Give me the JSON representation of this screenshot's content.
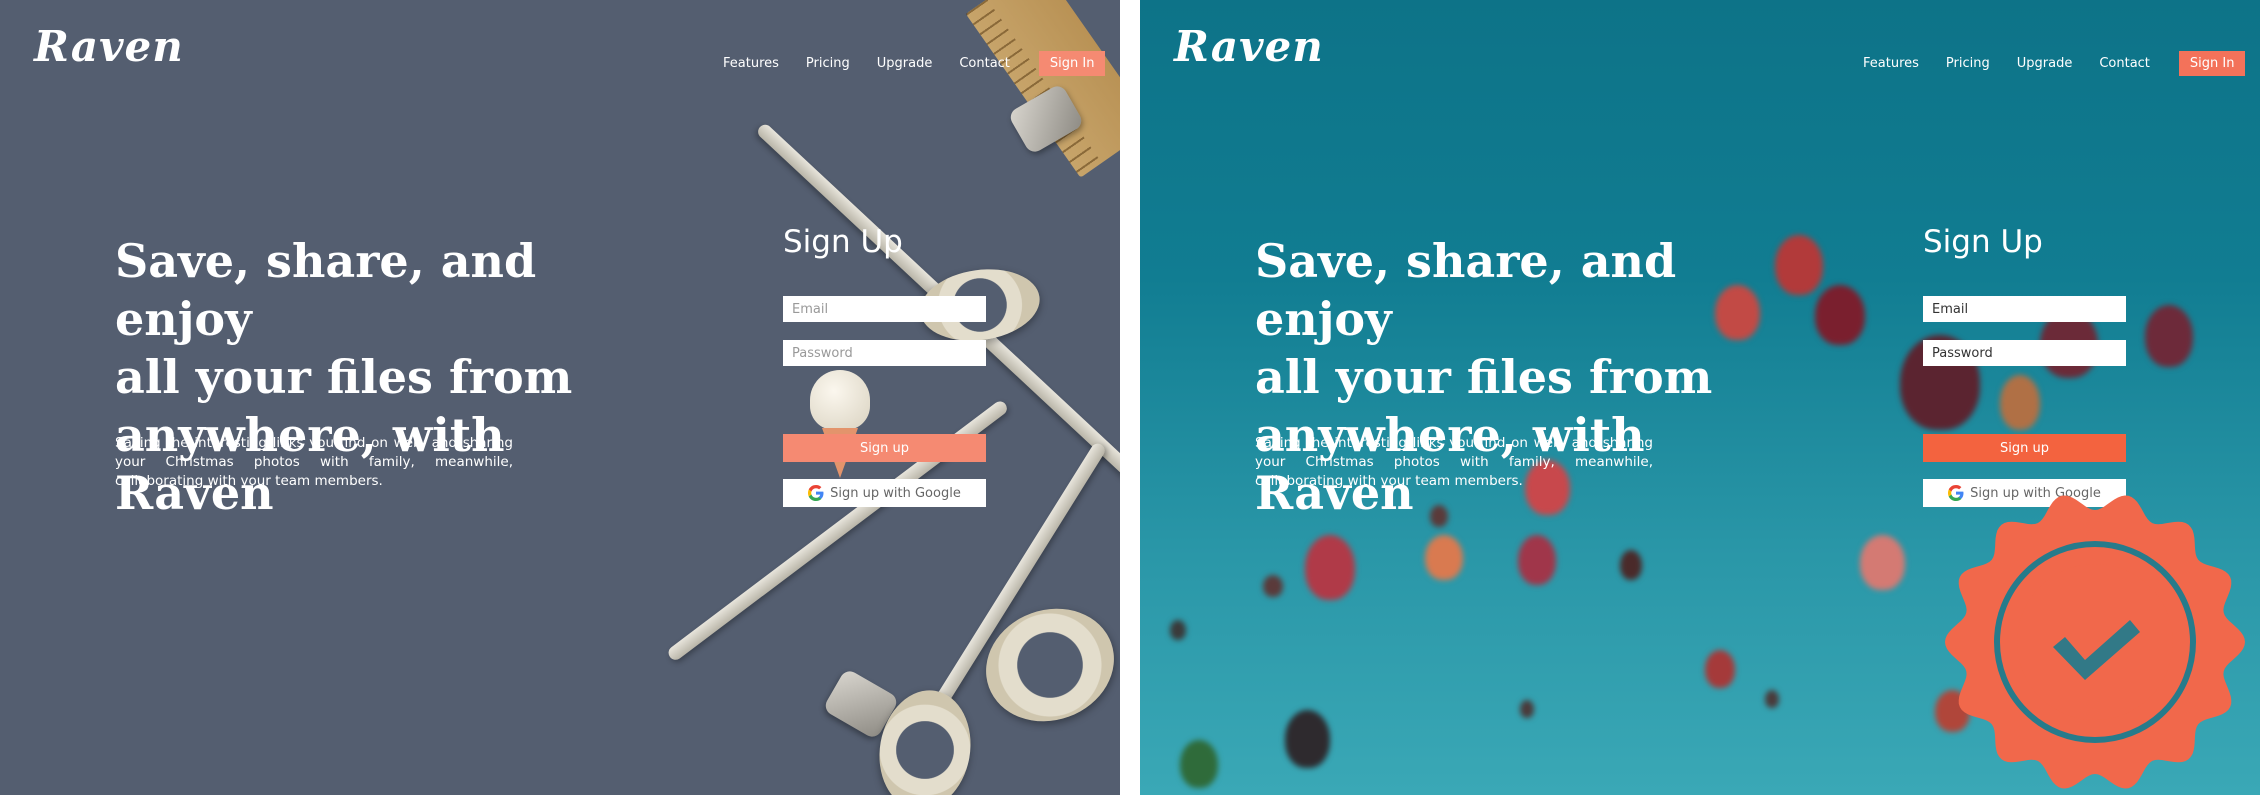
{
  "left": {
    "logo": "Raven",
    "nav": [
      "Features",
      "Pricing",
      "Upgrade",
      "Contact"
    ],
    "signin": "Sign In",
    "headline": [
      "Save, share, and enjoy",
      "all your files from",
      "anywhere, with Raven"
    ],
    "subtext": "Saving the interesting links you find on web, and sharing your Christmas photos with family, meanwhile, collaborating with your team members.",
    "form_title": "Sign Up",
    "email_placeholder": "Email",
    "password_placeholder": "Password",
    "signup_button": "Sign up",
    "google_button": "Sign up with Google"
  },
  "right": {
    "logo": "Raven",
    "nav": [
      "Features",
      "Pricing",
      "Upgrade",
      "Contact"
    ],
    "signin": "Sign In",
    "headline": [
      "Save, share, and enjoy",
      "all your files from",
      "anywhere, with Raven"
    ],
    "subtext": "Saving the interesting links you find on web, and sharing your Christmas photos with family, meanwhile, collaborating with your team members.",
    "form_title": "Sign Up",
    "email_placeholder": "Email",
    "password_placeholder": "Password",
    "signup_button": "Sign up",
    "google_button": "Sign up with Google"
  },
  "colors": {
    "left_background": "#545e70",
    "right_background": "#117d92",
    "accent": "#f3633f",
    "accent_muted": "#f58a72",
    "text": "#ffffff"
  },
  "icons": [
    "google-icon",
    "verified-badge-icon"
  ]
}
